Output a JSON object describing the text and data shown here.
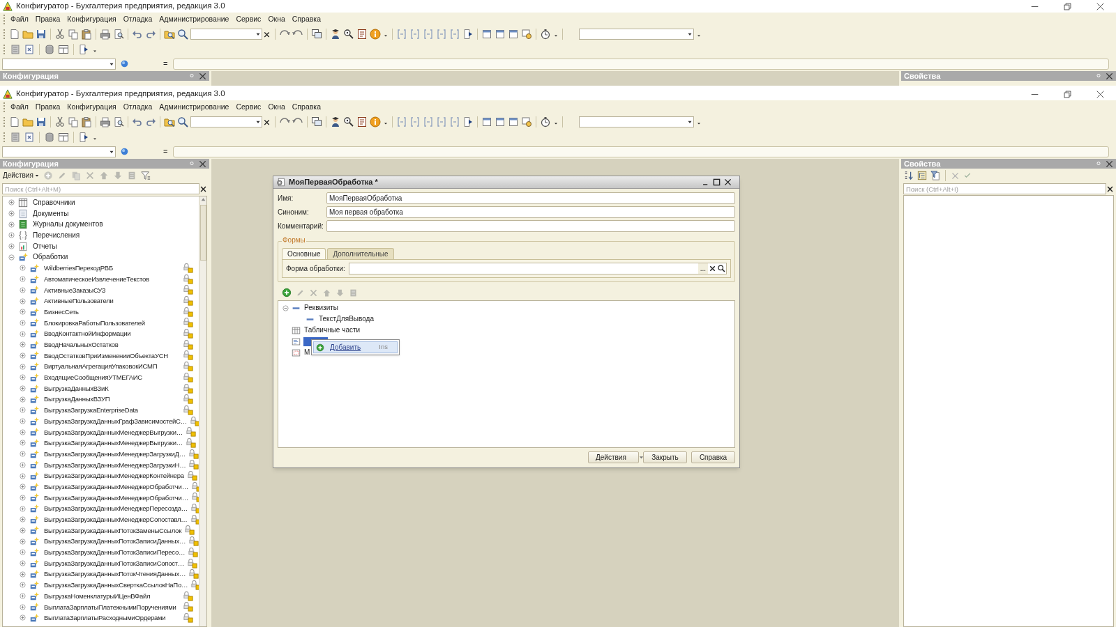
{
  "back_window": {
    "title": "Конфигуратор - Бухгалтерия предприятия, редакция 3.0",
    "menu": [
      "Файл",
      "Правка",
      "Конфигурация",
      "Отладка",
      "Администрирование",
      "Сервис",
      "Окна",
      "Справка"
    ],
    "formula_bar": {
      "operator": "="
    },
    "left_panel": {
      "title": "Конфигурация"
    },
    "right_panel": {
      "title": "Свойства"
    }
  },
  "front_window": {
    "title": "Конфигуратор - Бухгалтерия предприятия, редакция 3.0",
    "menu": [
      "Файл",
      "Правка",
      "Конфигурация",
      "Отладка",
      "Администрирование",
      "Сервис",
      "Окна",
      "Справка"
    ],
    "formula_bar": {
      "operator": "="
    },
    "left_panel": {
      "title": "Конфигурация",
      "actions_label": "Действия",
      "search": {
        "placeholder": "Поиск (Ctrl+Alt+M)"
      },
      "tree": [
        {
          "label": "Справочники",
          "kind": "catalogs",
          "expanded": false
        },
        {
          "label": "Документы",
          "kind": "documents",
          "expanded": false
        },
        {
          "label": "Журналы документов",
          "kind": "journals",
          "expanded": false
        },
        {
          "label": "Перечисления",
          "kind": "enums",
          "expanded": false
        },
        {
          "label": "Отчеты",
          "kind": "reports",
          "expanded": false
        },
        {
          "label": "Обработки",
          "kind": "processings",
          "expanded": true,
          "children": [
            {
              "label": "WildberriesПереходРВБ",
              "expanded": false
            },
            {
              "label": "АвтоматическоеИзвлечениеТекстов",
              "expanded": false
            },
            {
              "label": "АктивныеЗаказыСУЗ",
              "expanded": false
            },
            {
              "label": "АктивныеПользователи",
              "expanded": false
            },
            {
              "label": "БизнесСеть",
              "expanded": false
            },
            {
              "label": "БлокировкаРаботыПользователей",
              "expanded": false
            },
            {
              "label": "ВводКонтактнойИнформации",
              "expanded": false
            },
            {
              "label": "ВводНачальныхОстатков",
              "expanded": false
            },
            {
              "label": "ВводОстатковПриИзмененииОбъектаУСН",
              "expanded": false
            },
            {
              "label": "ВиртуальнаяАгрегацияУпаковокИСМП",
              "expanded": false
            },
            {
              "label": "ВходящиеСообщенияУТМЕГАИС",
              "expanded": false
            },
            {
              "label": "ВыгрузкаДанныхВЗиК",
              "expanded": false
            },
            {
              "label": "ВыгрузкаДанныхВЗУП",
              "expanded": false
            },
            {
              "label": "ВыгрузкаЗагрузкаEnterpriseData",
              "expanded": false
            },
            {
              "label": "ВыгрузкаЗагрузкаДанныхГрафЗависимостейС…",
              "expanded": false
            },
            {
              "label": "ВыгрузкаЗагрузкаДанныхМенеджерВыгрузки…",
              "expanded": false
            },
            {
              "label": "ВыгрузкаЗагрузкаДанныхМенеджерВыгрузки…",
              "expanded": false
            },
            {
              "label": "ВыгрузкаЗагрузкаДанныхМенеджерЗагрузкиД…",
              "expanded": false
            },
            {
              "label": "ВыгрузкаЗагрузкаДанныхМенеджерЗагрузкиН…",
              "expanded": false
            },
            {
              "label": "ВыгрузкаЗагрузкаДанныхМенеджерКонтейнера",
              "expanded": false
            },
            {
              "label": "ВыгрузкаЗагрузкаДанныхМенеджерОбработчи…",
              "expanded": false
            },
            {
              "label": "ВыгрузкаЗагрузкаДанныхМенеджерОбработчи…",
              "expanded": false
            },
            {
              "label": "ВыгрузкаЗагрузкаДанныхМенеджерПересозда…",
              "expanded": false
            },
            {
              "label": "ВыгрузкаЗагрузкаДанныхМенеджерСопоставл…",
              "expanded": false
            },
            {
              "label": "ВыгрузкаЗагрузкаДанныхПотокЗаменыСсылок",
              "expanded": false
            },
            {
              "label": "ВыгрузкаЗагрузкаДанныхПотокЗаписиДанных…",
              "expanded": false
            },
            {
              "label": "ВыгрузкаЗагрузкаДанныхПотокЗаписиПересо…",
              "expanded": false
            },
            {
              "label": "ВыгрузкаЗагрузкаДанныхПотокЗаписиСопост…",
              "expanded": false
            },
            {
              "label": "ВыгрузкаЗагрузкаДанныхПотокЧтенияДанных…",
              "expanded": false
            },
            {
              "label": "ВыгрузкаЗагрузкаДанныхСверткаСсылокНаПо…",
              "expanded": false
            },
            {
              "label": "ВыгрузкаНоменклатурыИЦенВФайл",
              "expanded": false
            },
            {
              "label": "ВыплатаЗарплатыПлатежнымиПоручениями",
              "expanded": false
            },
            {
              "label": "ВыплатаЗарплатыРасходнымиОрдерами",
              "expanded": false
            }
          ]
        }
      ]
    },
    "right_panel": {
      "title": "Свойства",
      "search": {
        "placeholder": "Поиск (Ctrl+Alt+I)"
      }
    },
    "dialog": {
      "title": "МояПерваяОбработка *",
      "fields": [
        {
          "label": "Имя:",
          "value": "МояПерваяОбработка"
        },
        {
          "label": "Синоним:",
          "value": "Моя первая обработка"
        },
        {
          "label": "Комментарий:"
        }
      ],
      "forms_group": {
        "title": "Формы",
        "tabs": [
          {
            "label": "Основные",
            "selected": true
          },
          {
            "label": "Дополнительные",
            "selected": false
          }
        ],
        "field": {
          "label": "Форма обработки:",
          "select_button": "..."
        }
      },
      "tree": [
        {
          "label": "Реквизиты",
          "kind": "attributes",
          "expanded": true,
          "selected": false,
          "children": [
            {
              "label": "ТекстДляВывода",
              "kind": "attribute",
              "selected": false
            }
          ]
        },
        {
          "label": "Табличные части",
          "kind": "tables",
          "selected": false
        },
        {
          "kind": "forms",
          "selected": true
        },
        {
          "label": "М",
          "kind": "templates",
          "selected": false
        }
      ],
      "context_menu": [
        {
          "label": "Добавить",
          "shortcut": "Ins",
          "selected": true
        }
      ],
      "buttons": [
        {
          "label": "Действия",
          "dropdown": true
        },
        {
          "label": "Закрыть",
          "dropdown": false
        },
        {
          "label": "Справка",
          "dropdown": false
        }
      ]
    }
  }
}
